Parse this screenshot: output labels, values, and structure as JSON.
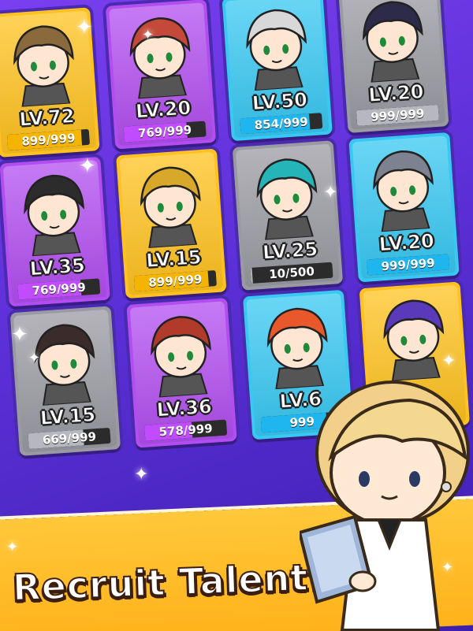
{
  "cards": [
    {
      "id": "c1",
      "level": "LV.72",
      "exp": "899/999",
      "exp_fraction": 0.9,
      "frame": "gold"
    },
    {
      "id": "c2",
      "level": "LV.20",
      "exp": "769/999",
      "exp_fraction": 0.77,
      "frame": "purple"
    },
    {
      "id": "c3",
      "level": "LV.50",
      "exp": "854/999",
      "exp_fraction": 0.85,
      "frame": "blue"
    },
    {
      "id": "c4",
      "level": "LV.20",
      "exp": "999/999",
      "exp_fraction": 1.0,
      "frame": "gray"
    },
    {
      "id": "c5",
      "level": "LV.35",
      "exp": "769/999",
      "exp_fraction": 0.77,
      "frame": "purple"
    },
    {
      "id": "c6",
      "level": "LV.15",
      "exp": "899/999",
      "exp_fraction": 0.9,
      "frame": "gold"
    },
    {
      "id": "c7",
      "level": "LV.25",
      "exp": "10/500",
      "exp_fraction": 0.02,
      "frame": "gray"
    },
    {
      "id": "c8",
      "level": "LV.20",
      "exp": "999/999",
      "exp_fraction": 1.0,
      "frame": "blue"
    },
    {
      "id": "c9",
      "level": "LV.15",
      "exp": "669/999",
      "exp_fraction": 0.67,
      "frame": "gray"
    },
    {
      "id": "c10",
      "level": "LV.36",
      "exp": "578/999",
      "exp_fraction": 0.58,
      "frame": "purple"
    },
    {
      "id": "c11",
      "level": "LV.6",
      "exp": "999",
      "exp_fraction": 0.8,
      "frame": "blue"
    },
    {
      "id": "c12",
      "level": "",
      "exp": "",
      "exp_fraction": 0,
      "frame": "gold"
    }
  ],
  "banner": {
    "title": "Recruit Talent!"
  },
  "colors": {
    "gold": "#ffc21f",
    "purple": "#b24ef0",
    "blue": "#38c8f2",
    "gray": "#9a9aa2",
    "fill_gold": "#f5b400",
    "fill_purple": "#c14bff",
    "fill_blue": "#1fb6ef",
    "fill_gray": "#b7b7bf",
    "hair": [
      "#8a6a3c",
      "#c4493a",
      "#d8d8d8",
      "#2e2a4a",
      "#2c2c2c",
      "#d8a82a",
      "#25b4b8",
      "#7e8290",
      "#3b2b2b",
      "#b23a2a",
      "#e8582a",
      "#5a3ab8"
    ]
  }
}
